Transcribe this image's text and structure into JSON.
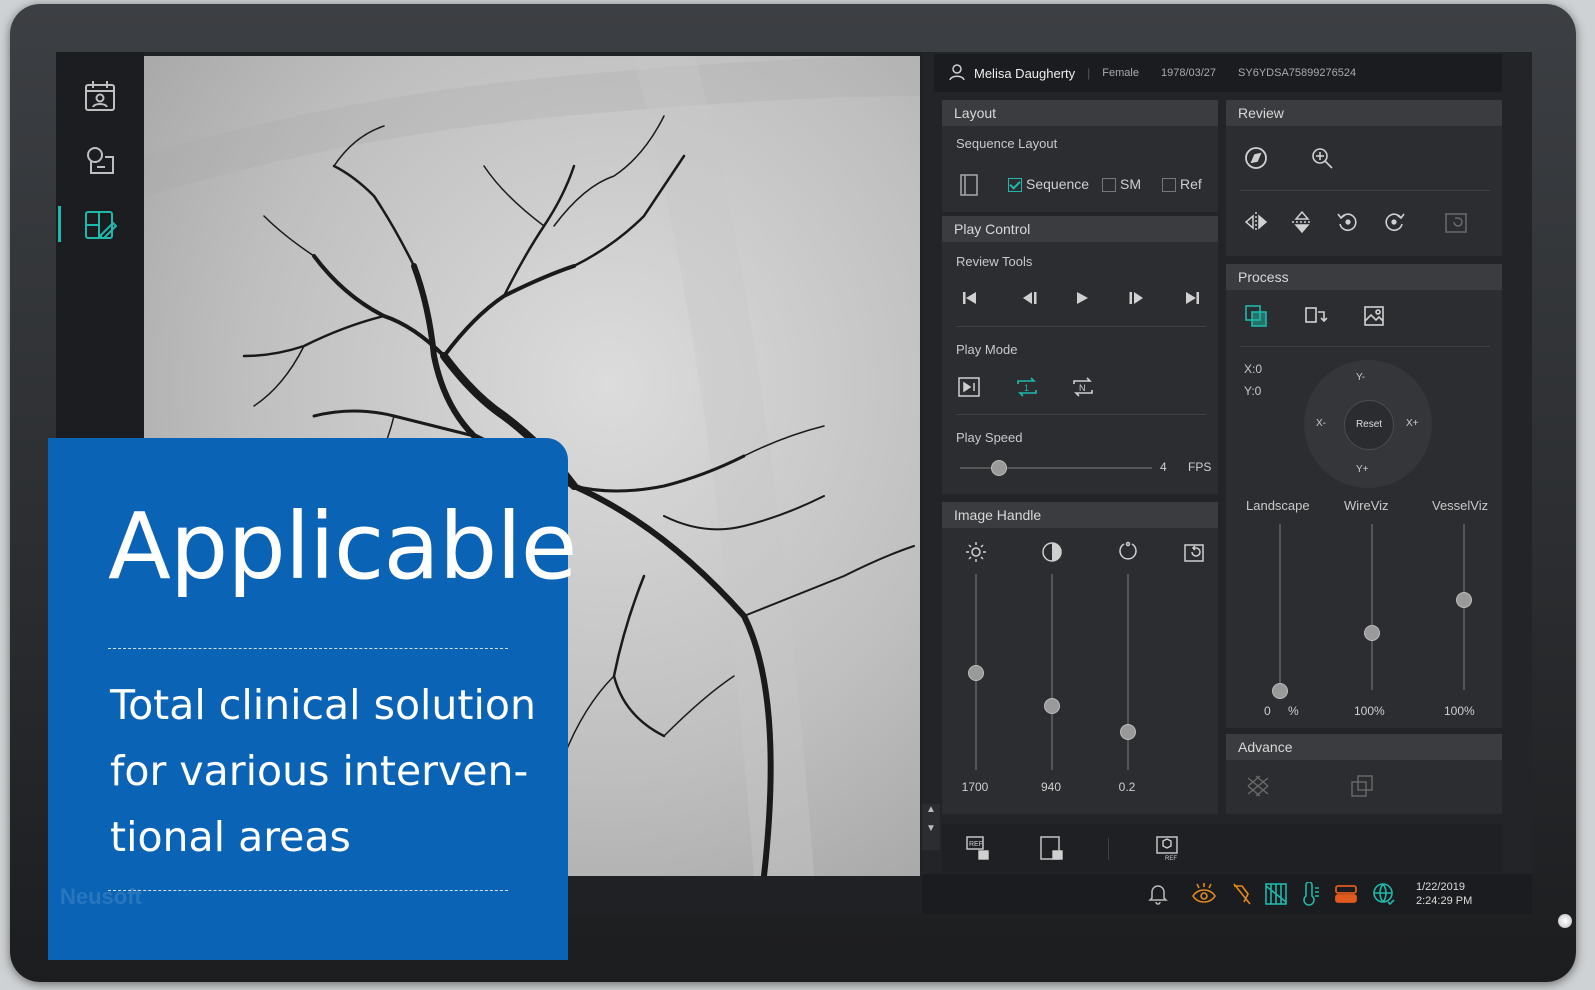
{
  "patient": {
    "name": "Melisa Daugherty",
    "gender": "Female",
    "dob": "1978/03/27",
    "id": "SY6YDSA75899276524"
  },
  "layout": {
    "title": "Layout",
    "sequence_layout": "Sequence Layout",
    "opt_sequence": "Sequence",
    "opt_sm": "SM",
    "opt_ref": "Ref",
    "sequence_checked": true
  },
  "review": {
    "title": "Review"
  },
  "play_control": {
    "title": "Play Control",
    "review_tools": "Review Tools",
    "play_mode": "Play Mode",
    "play_speed": "Play Speed",
    "speed_value": "4",
    "speed_unit": "FPS",
    "speed_level": 0.2
  },
  "process": {
    "title": "Process",
    "x": "X:0",
    "y": "Y:0",
    "dpad": {
      "up": "Y-",
      "down": "Y+",
      "left": "X-",
      "right": "X+",
      "center": "Reset"
    },
    "sliders": [
      {
        "label": "Landscape",
        "value": "0",
        "unit": "%",
        "level": 0.0
      },
      {
        "label": "WireViz",
        "value": "100%",
        "level": 0.35
      },
      {
        "label": "VesselViz",
        "value": "100%",
        "level": 0.55
      }
    ]
  },
  "image_handle": {
    "title": "Image Handle",
    "values": [
      "1700",
      "940",
      "0.2"
    ],
    "levels": [
      0.5,
      0.33,
      0.2
    ]
  },
  "advance": {
    "title": "Advance"
  },
  "clock": {
    "date": "1/22/2019",
    "time": "2:24:29 PM"
  },
  "overlay": {
    "title": "Applicable",
    "line1": "Total clinical solution",
    "line2": "for various interven-",
    "line3": "tional areas",
    "watermark": "Neusoft"
  },
  "colors": {
    "accent": "#20b8aa",
    "overlay_blue": "#0a63b5",
    "warning": "#e08a1e"
  }
}
